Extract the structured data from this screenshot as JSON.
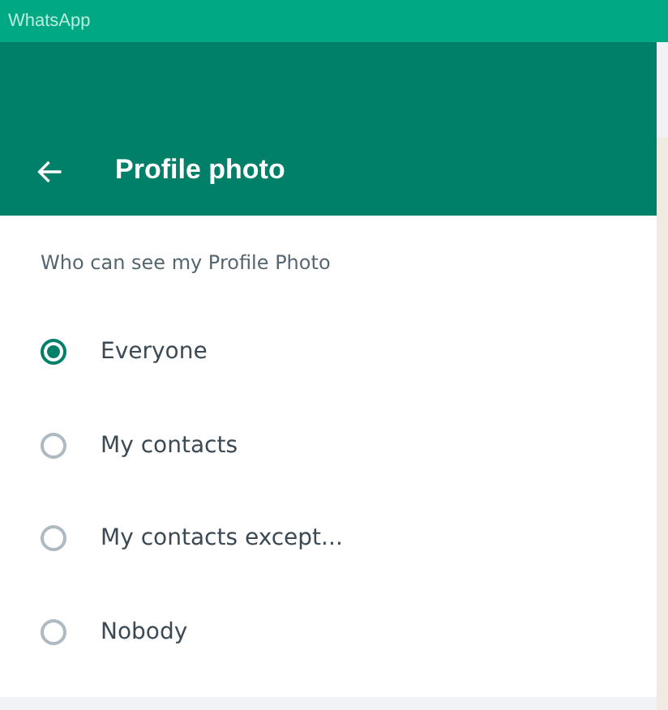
{
  "window": {
    "title": "WhatsApp"
  },
  "header": {
    "title": "Profile photo"
  },
  "section": {
    "label": "Who can see my Profile Photo"
  },
  "options": [
    {
      "label": "Everyone",
      "selected": true
    },
    {
      "label": "My contacts",
      "selected": false
    },
    {
      "label": "My contacts except...",
      "selected": false
    },
    {
      "label": "Nobody",
      "selected": false
    }
  ]
}
